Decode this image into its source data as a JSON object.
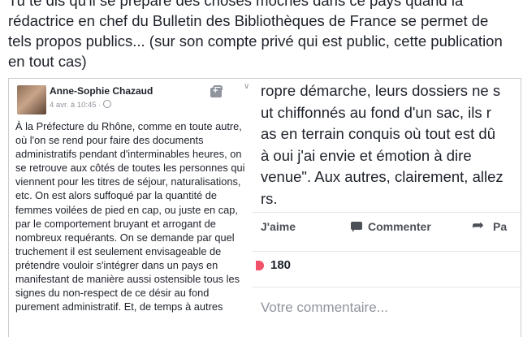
{
  "intro": {
    "text": "Tu te dis qu'il se prépare des choses moches dans ce pays quand la rédactrice en chef du Bulletin des Bibliothèques de France se permet de tels propos publics... (sur son compte privé qui est public, cette publication en tout cas)"
  },
  "left_post": {
    "author": "Anne-Sophie Chazaud",
    "date": "4 avr. à 10:45 · ",
    "globe_icon": "globe-icon",
    "body": "À la Préfecture du Rhône, comme en toute autre, où l'on se rend pour faire des documents administratifs pendant d'interminables heures, on se retrouve aux côtés de toutes les personnes qui viennent pour les titres de séjour, naturalisations, etc. On est alors suffoqué par la quantité de femmes voilées de pied en cap, ou juste en cap, par le comportement bruyant et arrogant de nombreux requérants. On se demande par quel truchement il est seulement envisageable de prétendre vouloir s'intégrer dans un pays en manifestant de manière aussi ostensible tous les signes du non-respect de ce désir au fond purement administratif. Et, de temps à autres"
  },
  "right_post": {
    "lines": [
      "ropre démarche, leurs dossiers ne s",
      "ut chiffonnés au fond d'un sac, ils r",
      "as en terrain conquis où tout est dû",
      "à oui j'ai envie et émotion à dire",
      "venue\". Aux autres, clairement, allez",
      "rs."
    ],
    "like_label": "J'aime",
    "comment_label": "Commenter",
    "share_label": "Pa",
    "reaction_count": "180",
    "comment_placeholder": "Votre commentaire..."
  },
  "colors": {
    "text": "#1d2129",
    "muted": "#90949c",
    "action": "#4b4f56",
    "reaction": "#f25268"
  }
}
